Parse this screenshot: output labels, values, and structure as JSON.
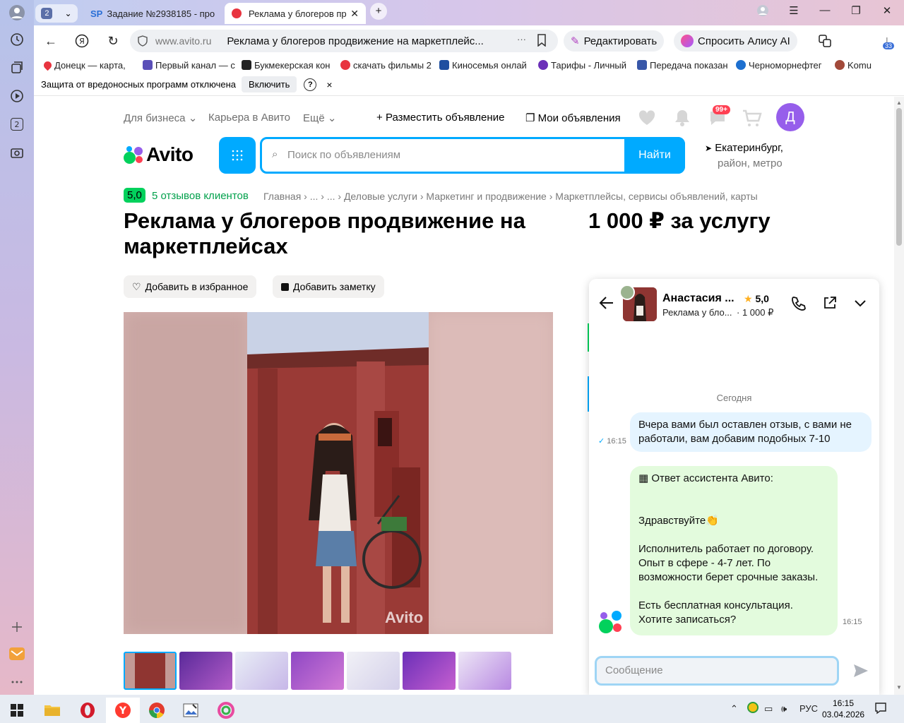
{
  "browser": {
    "tab_count": "2",
    "tabs": [
      {
        "label": "Задание №2938185 - про",
        "favicon": "SP"
      },
      {
        "label": "Реклама у блогеров пр"
      }
    ],
    "address": {
      "domain": "www.avito.ru",
      "page_title": "Реклама у блогеров продвижение на маркетплейс...",
      "more": "···"
    },
    "edit_button": "Редактировать",
    "alice_button": "Спросить Алису AI",
    "downloads_badge": "33",
    "bookmarks": [
      "Донецк — карта, ",
      "Первый канал — с",
      "Букмекерская кон",
      "скачать фильмы 2",
      "Киносемья онлай",
      "Тарифы - Личный",
      "Передача показан",
      "Черноморнефтег",
      "Komu"
    ],
    "infobar": {
      "text": "Защита от вредоносных программ отключена",
      "enable_button": "Включить",
      "help": "?",
      "close": "×"
    }
  },
  "avito": {
    "nav": {
      "for_business": "Для бизнеса",
      "career": "Карьера в Авито",
      "more": "Ещё",
      "post_ad": "Разместить объявление",
      "my_ads": "Мои объявления",
      "messages_badge": "99+",
      "avatar_letter": "Д"
    },
    "logo_text": "Avito",
    "search": {
      "placeholder": "Поиск по объявлениям",
      "button": "Найти"
    },
    "location": {
      "city": "Екатеринбург,",
      "sub": "район, метро"
    },
    "seller_rating": "5,0",
    "reviews": "5 отзывов клиентов",
    "breadcrumbs": "Главная  ›  ...  ›  ...  ›  Деловые услуги  ›  Маркетинг и продвижение  ›  Маркетплейсы, сервисы объявлений, карты",
    "title": "Реклама у блогеров продвижение на маркетплейсах",
    "price": "1 000 ₽ за услугу",
    "buttons": {
      "favorite": "Добавить в избранное",
      "note": "Добавить заметку"
    },
    "photo_watermark": "Avito"
  },
  "chat": {
    "name": "Анастасия ...",
    "rating": "5,0",
    "ad": "Реклама у бло...",
    "ad_price": "· 1 000 ₽",
    "date_divider": "Сегодня",
    "messages": [
      {
        "text": "Вчера вами был оставлен отзыв, с вами не работали, вам добавим подобных 7-10",
        "time": "16:15",
        "read": "✓"
      },
      {
        "line1": "▦ Ответ ассистента Авито:",
        "line2": "Здравствуйте👏",
        "line3": "Исполнитель работает по договору. Опыт в сфере - 4-7 лет. По возможности берет срочные заказы.",
        "line4": "Есть бесплатная консультация. Хотите записаться?",
        "time": "16:15"
      }
    ],
    "input_placeholder": "Сообщение"
  },
  "taskbar": {
    "lang": "РУС",
    "time": "16:15",
    "date": "03.04.2026"
  },
  "colors": {
    "avito_blue": "#00aaff",
    "avito_green": "#02d15c",
    "avatar_purple": "#965eeb",
    "badge_red": "#ff4053"
  }
}
